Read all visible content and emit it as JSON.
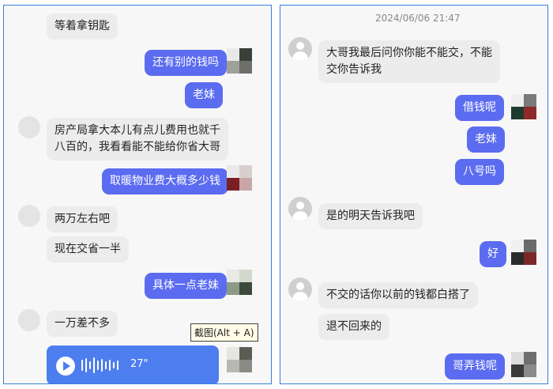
{
  "left_panel": {
    "messages": [
      {
        "text": "等着拿钥匙",
        "side": "incoming"
      },
      {
        "text": "还有别的钱吗",
        "side": "outgoing"
      },
      {
        "text": "老妹",
        "side": "outgoing"
      },
      {
        "text_line1": "房产局拿大本儿有点儿费用也就千",
        "text_line2": "八百的，我看看能不能给你省大哥",
        "side": "incoming"
      },
      {
        "text": "取暖物业费大概多少钱",
        "side": "outgoing"
      },
      {
        "text": "两万左右吧",
        "side": "incoming"
      },
      {
        "text": "现在交省一半",
        "side": "incoming"
      },
      {
        "text": "具体一点老妹",
        "side": "outgoing"
      },
      {
        "text": "一万差不多",
        "side": "incoming"
      }
    ],
    "screenshot_tooltip": "截图(Alt + A)",
    "voice_message": {
      "duration": "27\""
    }
  },
  "right_panel": {
    "timestamp": "2024/06/06 21:47",
    "messages": [
      {
        "text_line1": "大哥我最后问你你能不能交，不能",
        "text_line2": "交你告诉我",
        "side": "incoming"
      },
      {
        "text": "借钱呢",
        "side": "outgoing"
      },
      {
        "text": "老妹",
        "side": "outgoing"
      },
      {
        "text": "八号吗",
        "side": "outgoing"
      },
      {
        "text": "是的明天告诉我吧",
        "side": "incoming"
      },
      {
        "text": "好",
        "side": "outgoing"
      },
      {
        "text": "不交的话你以前的钱都白搭了",
        "side": "incoming"
      },
      {
        "text": "退不回来的",
        "side": "incoming"
      },
      {
        "text": "哥弄钱呢",
        "side": "outgoing"
      }
    ]
  },
  "colors": {
    "outgoing_bubble": "#5b6cf0",
    "incoming_bubble": "#ececec",
    "voice_bubble": "#4d7ef0",
    "panel_border": "#3b7de0"
  },
  "icons": [
    "default-avatar-icon",
    "pixelated-avatar-icon",
    "play-icon",
    "voice-wave-icon"
  ]
}
